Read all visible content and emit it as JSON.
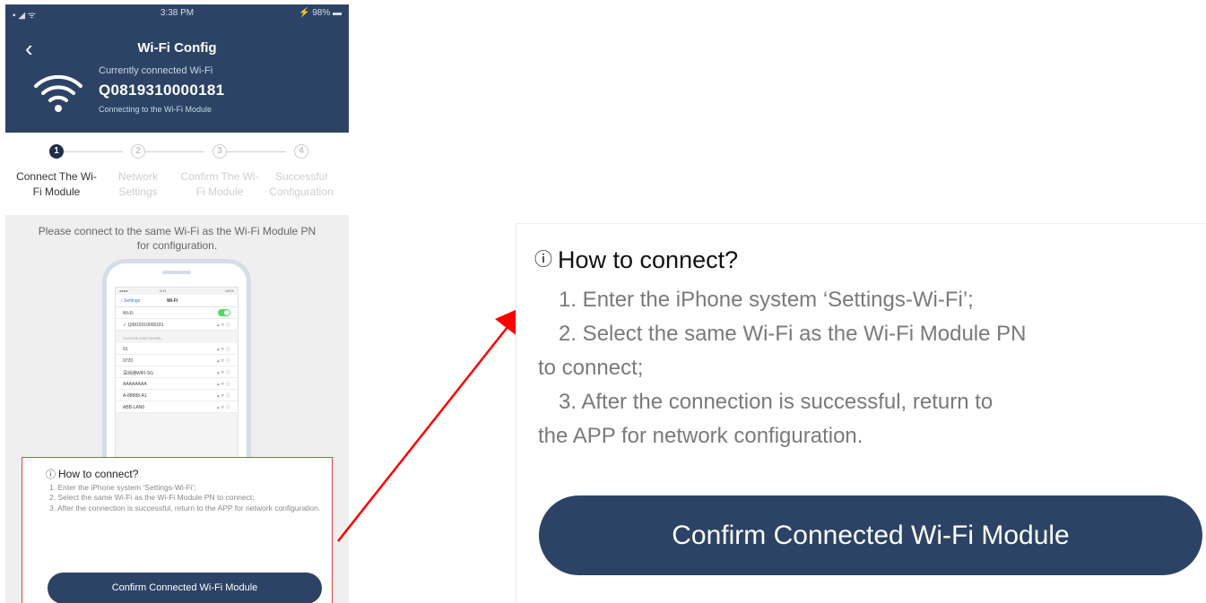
{
  "status_bar": {
    "left": "▪ ◢ ᯤ",
    "time": "3:38 PM",
    "right": "⚡ 98% ▬"
  },
  "header": {
    "back_icon": "‹",
    "title": "Wi-Fi Config",
    "connected_label": "Currently connected Wi-Fi",
    "ssid": "Q0819310000181",
    "status_text": "Connecting to the Wi-Fi Module"
  },
  "steps": [
    {
      "number": "1",
      "label": "Connect The Wi-Fi Module",
      "active": true
    },
    {
      "number": "2",
      "label": "Network Settings",
      "active": false
    },
    {
      "number": "3",
      "label": "Confirm The Wi-Fi Module",
      "active": false
    },
    {
      "number": "4",
      "label": "Successful Configuration",
      "active": false
    }
  ],
  "instruction": "Please connect to the same Wi-Fi as the Wi-Fi Module PN for configuration.",
  "illustration": {
    "status_left": "●●●●",
    "status_time": "9:41",
    "status_right": "100%",
    "nav_back": "‹ Settings",
    "nav_title": "Wi-Fi",
    "wifi_row": "Wi-Fi",
    "current_network": "✓ Q0819310000181",
    "section_header": "CHOOSE A NETWORK...",
    "networks": [
      "01",
      "0720",
      "深圳通WIFI-5G",
      "AAAAAAAA",
      "A-88888-A1",
      "ABB-LAN6"
    ],
    "signal_icon": "▴ ᯤ ⓘ"
  },
  "how_to_connect": {
    "icon": "ⓘ",
    "title": "How to connect?",
    "steps": [
      "1. Enter the iPhone system ‘Settings-Wi-Fi’;",
      "2. Select the same Wi-Fi as the Wi-Fi Module PN to connect;",
      "3. After the connection is successful, return to the APP for network configuration."
    ],
    "zoom_lines": [
      "1. Enter the iPhone system ‘Settings-Wi-Fi’;",
      "2. Select the same Wi-Fi as the Wi-Fi Module PN",
      "to connect;",
      "3. After the connection is successful, return to",
      "the APP for network configuration."
    ],
    "button_label": "Confirm Connected Wi-Fi Module"
  },
  "colors": {
    "header_bg": "#2c4366",
    "button_bg": "#2c4366",
    "highlight_border": "#e04545",
    "arrow": "#ff0000"
  }
}
